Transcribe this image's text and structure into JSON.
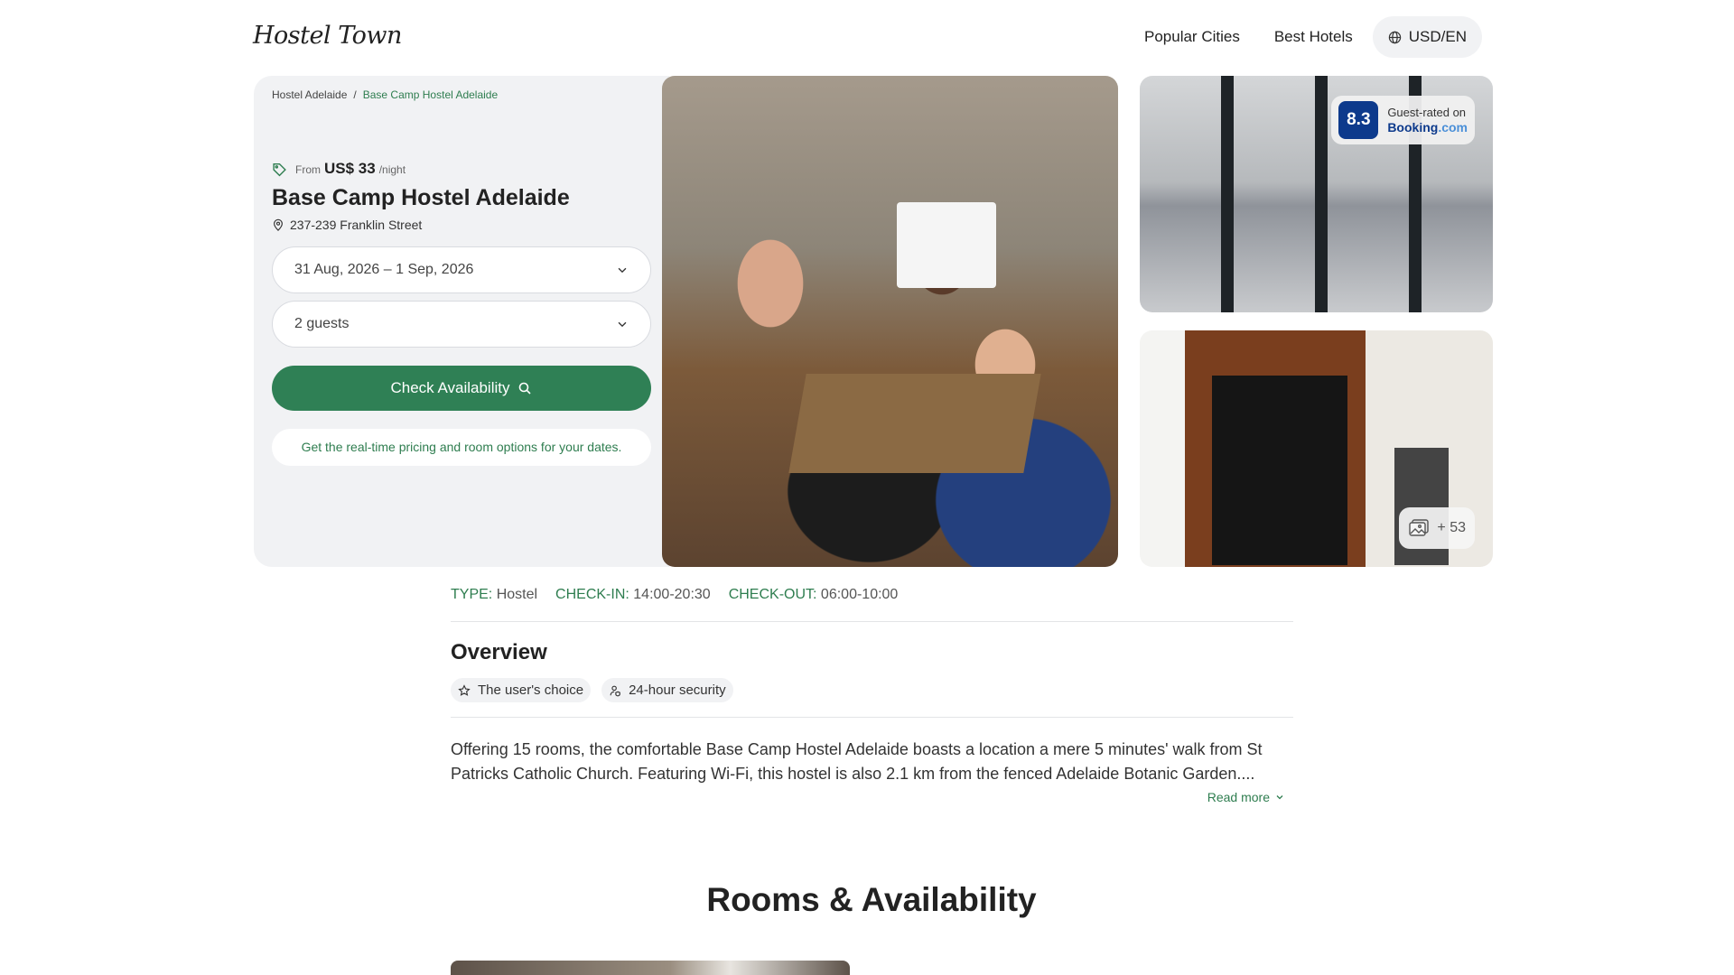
{
  "header": {
    "logo": "Hostel Town",
    "nav": [
      "Popular Cities",
      "Best Hotels"
    ],
    "currency": "USD/EN"
  },
  "breadcrumb": [
    "Hostel Adelaide",
    "Base Camp Hostel Adelaide"
  ],
  "hotel": {
    "price_prefix": "From",
    "price": "US$ 33",
    "price_suffix": "/night",
    "name": "Base Camp Hostel Adelaide",
    "address": "237-239 Franklin Street"
  },
  "booking": {
    "dates": "31 Aug, 2026 – 1 Sep, 2026",
    "guests": "2 guests",
    "button": "Check Availability",
    "note": "Get the real-time pricing and room options for your dates."
  },
  "rating": {
    "score": "8.3",
    "label": "Guest-rated on",
    "brand": "Booking",
    "brand_suffix": ".com"
  },
  "gallery": {
    "more": "+ 53"
  },
  "facts": [
    {
      "key": "TYPE:",
      "value": "Hostel"
    },
    {
      "key": "CHECK-IN:",
      "value": "14:00-20:30"
    },
    {
      "key": "CHECK-OUT:",
      "value": "06:00-10:00"
    }
  ],
  "overview": {
    "title": "Overview",
    "chips": [
      "The user's choice",
      "24-hour security"
    ],
    "description": "Offering 15 rooms, the comfortable Base Camp Hostel Adelaide boasts a location a mere 5 minutes' walk from St Patricks Catholic Church. Featuring Wi-Fi, this hostel is also 2.1 km from the fenced Adelaide Botanic Garden....",
    "read_more": "Read more"
  },
  "rooms": {
    "title": "Rooms & Availability"
  },
  "colors": {
    "accent": "#2f8055",
    "panel": "#f1f2f4",
    "booking_blue": "#0d3a8c"
  }
}
